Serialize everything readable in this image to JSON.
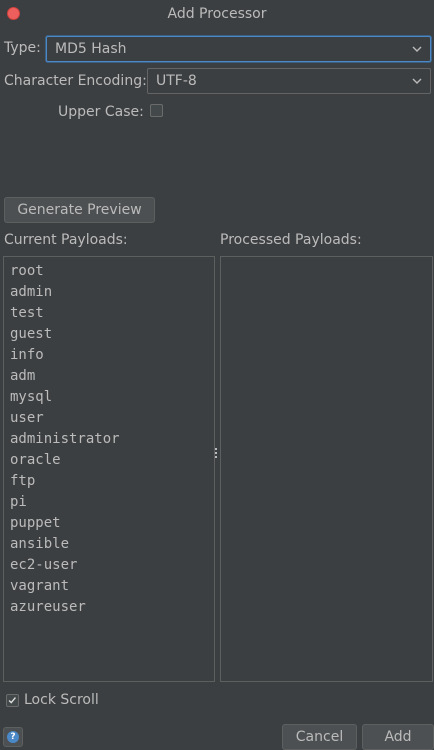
{
  "window": {
    "title": "Add Processor"
  },
  "type_row": {
    "label": "Type:",
    "value": "MD5 Hash"
  },
  "encoding_row": {
    "label": "Character Encoding:",
    "value": "UTF-8"
  },
  "upper_case": {
    "label": "Upper Case:",
    "checked": false
  },
  "generate_preview": {
    "label": "Generate Preview"
  },
  "current_payloads": {
    "header": "Current Payloads:",
    "items": [
      "root",
      "admin",
      "test",
      "guest",
      "info",
      "adm",
      "mysql",
      "user",
      "administrator",
      "oracle",
      "ftp",
      "pi",
      "puppet",
      "ansible",
      "ec2-user",
      "vagrant",
      "azureuser"
    ]
  },
  "processed_payloads": {
    "header": "Processed Payloads:",
    "items": []
  },
  "lock_scroll": {
    "label": "Lock Scroll",
    "checked": true
  },
  "footer": {
    "help_glyph": "?",
    "cancel_label": "Cancel",
    "add_label": "Add"
  },
  "icons": {
    "close": "close-icon",
    "chevron": "chevron-down-icon",
    "help": "help-icon",
    "check": "checkmark-icon"
  },
  "colors": {
    "background": "#3c3f41",
    "text": "#bbbbbb",
    "focus_border": "#4a88c7",
    "close_button": "#ec5f5d"
  }
}
